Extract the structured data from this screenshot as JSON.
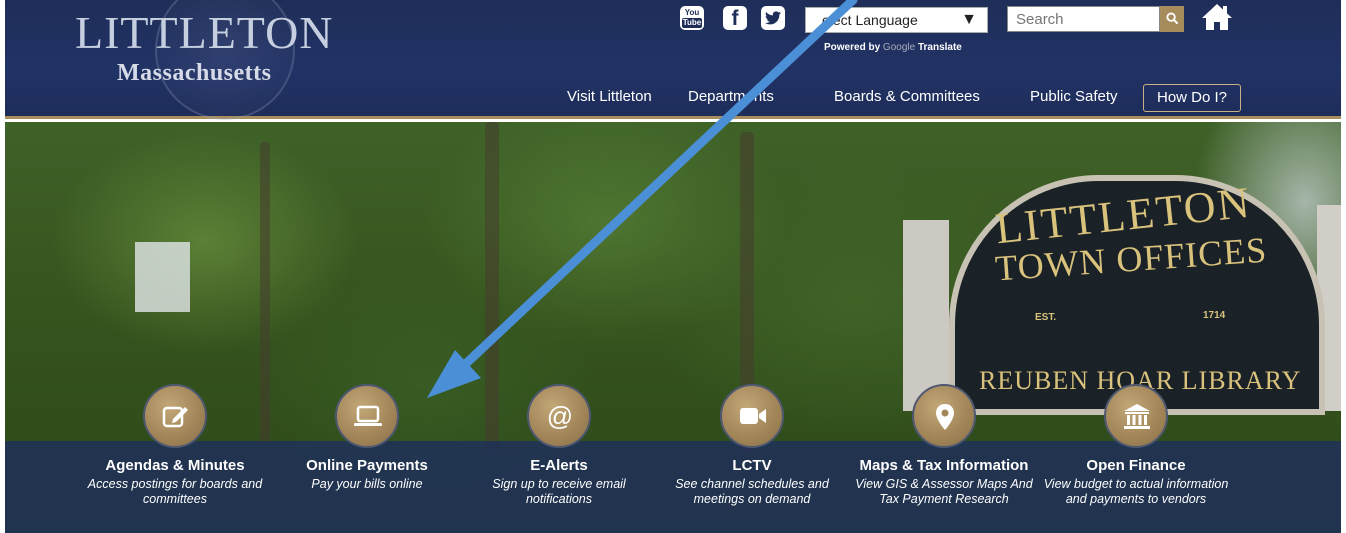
{
  "header": {
    "brand_title": "LITTLETON",
    "brand_subtitle": "Massachusetts",
    "social": {
      "youtube_line1": "You",
      "youtube_line2": "Tube",
      "facebook": "f",
      "twitter": "t"
    },
    "language_select": {
      "value": "elect Language",
      "arrow": "▼"
    },
    "powered_by": {
      "prefix": "Powered by",
      "google": "Google",
      "suffix": "Translate"
    },
    "search": {
      "placeholder": "Search",
      "button_icon": "search-icon"
    },
    "home_icon": "home-icon"
  },
  "nav": {
    "items": [
      {
        "label": "Visit Littleton"
      },
      {
        "label": "Departments"
      },
      {
        "label": "Boards & Committees"
      },
      {
        "label": "Public Safety"
      },
      {
        "label": "How Do I?"
      }
    ]
  },
  "hero": {
    "sign": {
      "line1": "LITTLETON",
      "line2": "TOWN OFFICES",
      "est": "EST.",
      "year": "1714",
      "bottom": "REUBEN HOAR LIBRARY"
    }
  },
  "quick_links": [
    {
      "title": "Agendas & Minutes",
      "desc": "Access postings for boards and committees",
      "icon": "edit-icon"
    },
    {
      "title": "Online Payments",
      "desc": "Pay your bills online",
      "icon": "laptop-icon"
    },
    {
      "title": "E-Alerts",
      "desc": "Sign up to receive email notifications",
      "icon": "at-icon"
    },
    {
      "title": "LCTV",
      "desc": "See channel schedules and meetings on demand",
      "icon": "video-icon"
    },
    {
      "title": "Maps & Tax Information",
      "desc": "View GIS & Assessor Maps And Tax Payment Research",
      "icon": "map-pin-icon"
    },
    {
      "title": "Open Finance",
      "desc": "View budget to actual information and payments to vendors",
      "icon": "bank-icon"
    }
  ],
  "colors": {
    "header_bg": "#213265",
    "gold": "#a68b5b",
    "annotation_arrow": "#4b8fd6"
  }
}
